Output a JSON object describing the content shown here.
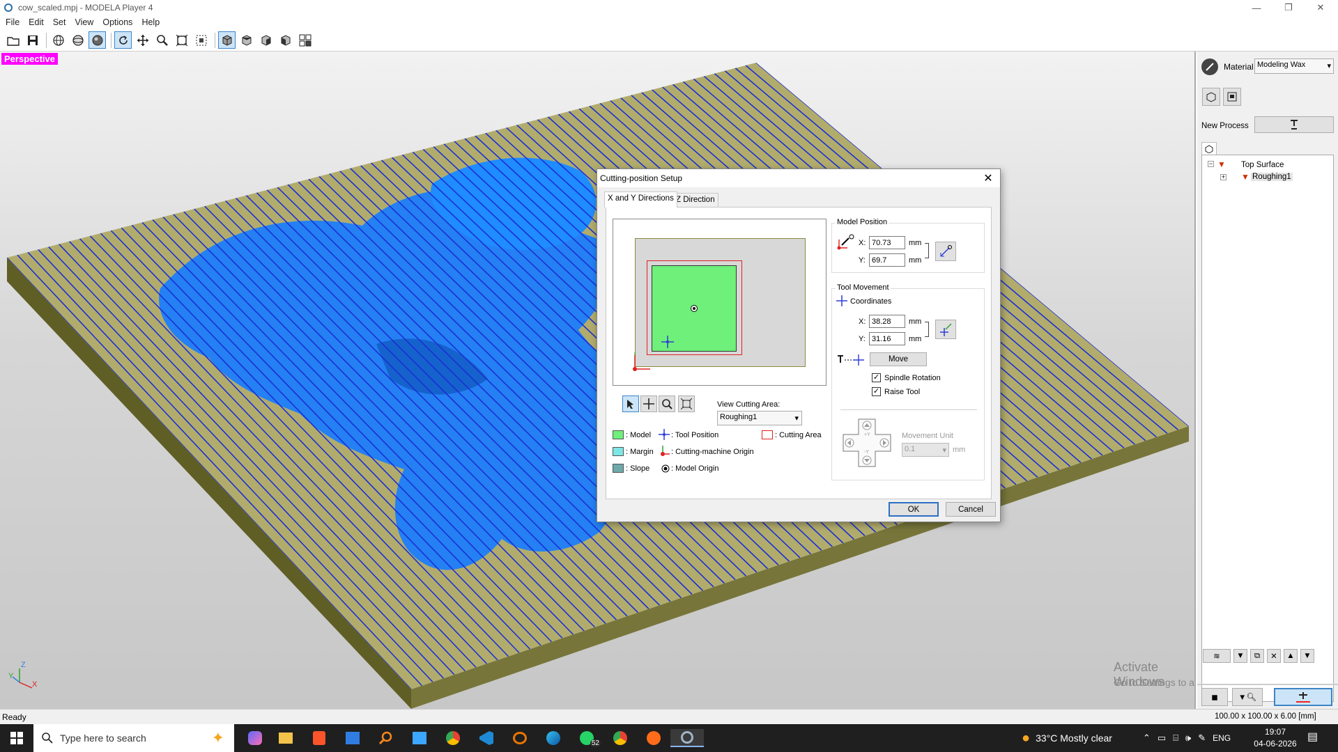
{
  "window": {
    "title": "cow_scaled.mpj - MODELA Player 4"
  },
  "menu": [
    "File",
    "Edit",
    "Set",
    "View",
    "Options",
    "Help"
  ],
  "viewport": {
    "label": "Perspective",
    "watermark_title": "Activate Windows",
    "watermark_sub": "Go to Settings to activate Windows."
  },
  "rightpanel": {
    "material_label": "Material",
    "material_value": "Modeling Wax",
    "new_process_label": "New Process",
    "tree": {
      "root": "Top Surface",
      "child": "Roughing1"
    }
  },
  "dialog": {
    "title": "Cutting-position Setup",
    "tabs": [
      "X and Y Directions",
      "Z Direction"
    ],
    "view_cutting_area_label": "View Cutting Area:",
    "view_cutting_area_value": "Roughing1",
    "legend": {
      "model": ": Model",
      "margin": ": Margin",
      "slope": ": Slope",
      "tool_position": ": Tool Position",
      "machine_origin": ": Cutting-machine Origin",
      "model_origin": ": Model Origin",
      "cutting_area": ": Cutting Area"
    },
    "model_position": {
      "title": "Model Position",
      "x_label": "X:",
      "x_value": "70.73",
      "y_label": "Y:",
      "y_value": "69.7",
      "unit": "mm"
    },
    "tool_movement": {
      "title": "Tool Movement",
      "coordinates_label": "Coordinates",
      "x_label": "X:",
      "x_value": "38.28",
      "y_label": "Y:",
      "y_value": "31.16",
      "unit": "mm",
      "move_label": "Move",
      "spindle_rotation": "Spindle Rotation",
      "raise_tool": "Raise Tool",
      "movement_unit_label": "Movement Unit",
      "movement_unit_value": "0.1",
      "movement_unit_unit": "mm"
    },
    "ok": "OK",
    "cancel": "Cancel"
  },
  "status": {
    "left": "Ready",
    "right": "100.00 x 100.00 x 6.00 [mm]"
  },
  "taskbar": {
    "search_placeholder": "Type here to search",
    "weather": "33°C  Mostly clear",
    "lang": "ENG",
    "time": "19:07",
    "date": "04-06-2026",
    "whatsapp_badge": "52"
  },
  "colors": {
    "model": "#6ef07a",
    "margin": "#7fe6e6",
    "slope": "#6fa9a9",
    "toolpath": "#1b2fd6",
    "material": "#8c8a3c",
    "highlight": "#ff00ff"
  }
}
